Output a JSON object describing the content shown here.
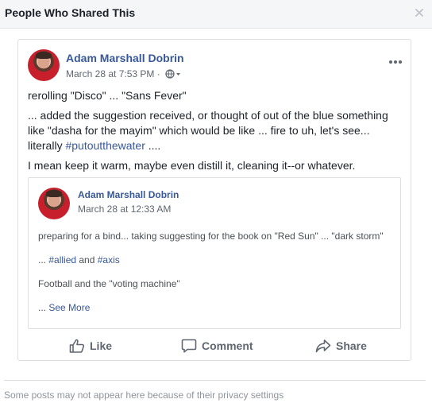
{
  "dialog": {
    "title": "People Who Shared This",
    "close_icon": "close-icon"
  },
  "post": {
    "author": "Adam Marshall Dobrin",
    "timestamp": "March 28 at 7:53 PM",
    "separator": "·",
    "privacy_icon": "globe-icon",
    "more_icon": "more-dots-icon",
    "paragraph1": "rerolling \"Disco\" ... \"Sans Fever\"",
    "paragraph2_line1": "... added the suggestion received, or thought of out of the blue something",
    "paragraph2_line2": "like \"dasha for the mayim\" which would be like ... fire to uh, let's see...",
    "paragraph2_line3_prefix": "literally ",
    "paragraph2_hashtag": "#putoutthewater",
    "paragraph2_line3_suffix": " ....",
    "paragraph3": "I mean keep it warm, maybe even distill it, cleaning it--or whatever."
  },
  "shared_post": {
    "author": "Adam Marshall Dobrin",
    "timestamp": "March 28 at 12:33 AM",
    "line1": "preparing for a bind... taking suggesting for the book on \"Red Sun\" ... \"dark storm\"",
    "line2_prefix": "... ",
    "hashtag_allied": "#allied",
    "line2_and": " and ",
    "hashtag_axis": "#axis",
    "line3": "Football and the \"voting machine\"",
    "line4_prefix": "... ",
    "see_more": "See More"
  },
  "actions": {
    "like": "Like",
    "comment": "Comment",
    "share": "Share",
    "like_icon": "thumbs-up-icon",
    "comment_icon": "comment-bubble-icon",
    "share_icon": "share-arrow-icon"
  },
  "footer": {
    "note": "Some posts may not appear here because of their privacy settings"
  },
  "colors": {
    "link": "#385898",
    "text": "#1d2129",
    "muted": "#606770",
    "border": "#dddfe2"
  }
}
